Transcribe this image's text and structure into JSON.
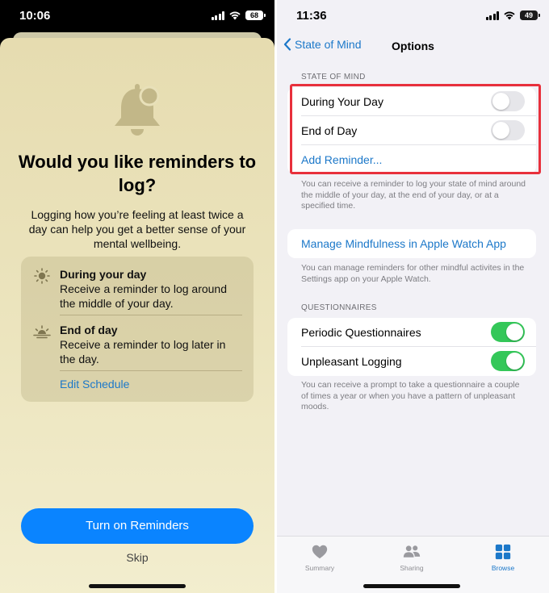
{
  "left_screen": {
    "status_bar": {
      "time": "10:06",
      "battery": "68"
    },
    "title": "Would you like reminders to log?",
    "body": "Logging how you’re feeling at least twice a day can help you get a better sense of your mental wellbeing.",
    "schedule": [
      {
        "title": "During your day",
        "description": "Receive a reminder to log around the middle of your day.",
        "icon": "sun-icon"
      },
      {
        "title": "End of day",
        "description": "Receive a reminder to log later in the day.",
        "icon": "sunset-icon"
      }
    ],
    "edit_schedule_label": "Edit Schedule",
    "primary_button_label": "Turn on Reminders",
    "skip_label": "Skip",
    "colors": {
      "accent": "#0a84ff",
      "link": "#1c78c9",
      "sheet_bg": "#ece5bf"
    }
  },
  "right_screen": {
    "status_bar": {
      "time": "11:36",
      "battery": "49"
    },
    "nav": {
      "back_label": "State of Mind",
      "title": "Options"
    },
    "state_of_mind": {
      "header": "STATE OF MIND",
      "rows": [
        {
          "label": "During Your Day",
          "toggle": "off"
        },
        {
          "label": "End of Day",
          "toggle": "off"
        }
      ],
      "add_reminder_label": "Add Reminder...",
      "footnote": "You can receive a reminder to log your state of mind around the middle of your day, at the end of your day, or at a specified time."
    },
    "mindfulness": {
      "link_label": "Manage Mindfulness in Apple Watch App",
      "footnote": "You can manage reminders for other mindful activites in the Settings app on your Apple Watch."
    },
    "questionnaires": {
      "header": "QUESTIONNAIRES",
      "rows": [
        {
          "label": "Periodic Questionnaires",
          "toggle": "on"
        },
        {
          "label": "Unpleasant Logging",
          "toggle": "on"
        }
      ],
      "footnote": "You can receive a prompt to take a questionnaire a couple of times a year or when you have a pattern of unpleasant moods."
    },
    "tab_bar": [
      {
        "label": "Summary",
        "icon": "heart-icon",
        "active": false
      },
      {
        "label": "Sharing",
        "icon": "people-icon",
        "active": false
      },
      {
        "label": "Browse",
        "icon": "grid-icon",
        "active": true
      }
    ],
    "colors": {
      "toggle_on": "#34c759",
      "highlight": "#e8303c",
      "link": "#1c78c9"
    }
  }
}
